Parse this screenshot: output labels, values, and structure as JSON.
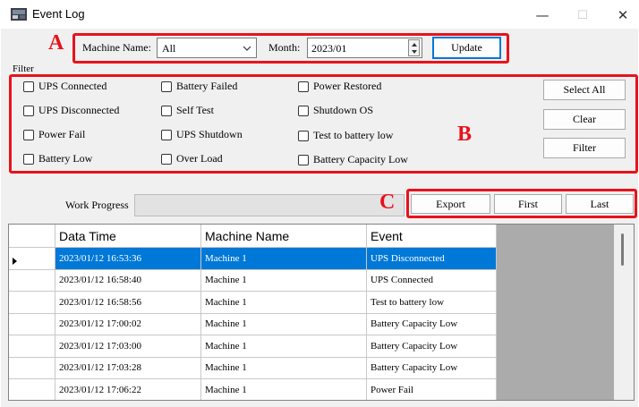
{
  "window": {
    "title": "Event Log",
    "controls": {
      "minimize": "—",
      "maximize": "☐",
      "close": "✕"
    }
  },
  "annotations": {
    "a": "A",
    "b": "B",
    "c": "C"
  },
  "toolbar": {
    "machine_label": "Machine Name:",
    "machine_value": "All",
    "month_label": "Month:",
    "month_value": "2023/01",
    "update_label": "Update"
  },
  "filter": {
    "group_label": "Filter",
    "options": [
      [
        "UPS Connected",
        "Battery Failed",
        "Power Restored"
      ],
      [
        "UPS Disconnected",
        "Self Test",
        "Shutdown OS"
      ],
      [
        "Power Fail",
        "UPS Shutdown",
        "Test to battery low"
      ],
      [
        "Battery Low",
        "Over Load",
        "Battery Capacity Low"
      ]
    ],
    "select_all_label": "Select All",
    "clear_label": "Clear",
    "filter_label": "Filter"
  },
  "progress": {
    "label": "Work Progress",
    "value": 0
  },
  "actions": {
    "export_label": "Export",
    "first_label": "First",
    "last_label": "Last"
  },
  "grid": {
    "columns": [
      "Data Time",
      "Machine Name",
      "Event"
    ],
    "rows": [
      [
        "2023/01/12 16:53:36",
        "Machine 1",
        "UPS Disconnected"
      ],
      [
        "2023/01/12 16:58:40",
        "Machine 1",
        "UPS Connected"
      ],
      [
        "2023/01/12 16:58:56",
        "Machine 1",
        "Test to battery low"
      ],
      [
        "2023/01/12 17:00:02",
        "Machine 1",
        "Battery Capacity Low"
      ],
      [
        "2023/01/12 17:03:00",
        "Machine 1",
        "Battery Capacity Low"
      ],
      [
        "2023/01/12 17:03:28",
        "Machine 1",
        "Battery Capacity Low"
      ],
      [
        "2023/01/12 17:06:22",
        "Machine 1",
        "Power Fail"
      ]
    ],
    "selected_row": 0
  },
  "colors": {
    "annotation": "#e8121b",
    "selection": "#0078d7"
  }
}
